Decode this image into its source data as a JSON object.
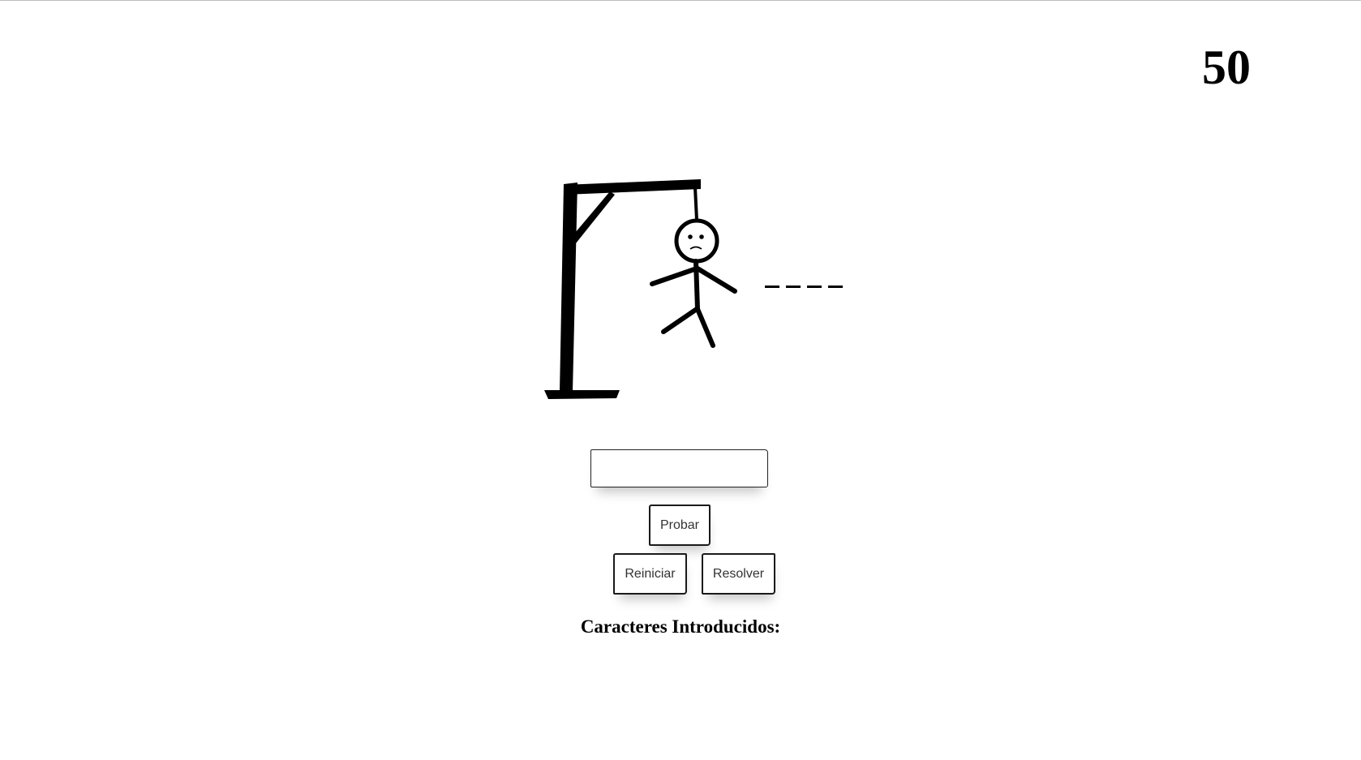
{
  "score": "50",
  "word": {
    "slots": [
      "_",
      "_",
      "_",
      "_"
    ],
    "revealed": [
      "",
      "",
      "",
      ""
    ]
  },
  "input": {
    "value": "",
    "placeholder": ""
  },
  "buttons": {
    "try_label": "Probar",
    "restart_label": "Reiniciar",
    "solve_label": "Resolver"
  },
  "entered": {
    "title": "Caracteres Introducidos:",
    "characters": ""
  },
  "hangman": {
    "state": "complete",
    "parts": [
      "gallows",
      "rope",
      "head",
      "body",
      "left-arm",
      "right-arm",
      "left-leg",
      "right-leg"
    ],
    "face": "sad"
  },
  "colors": {
    "ink": "#000000",
    "background": "#ffffff"
  }
}
